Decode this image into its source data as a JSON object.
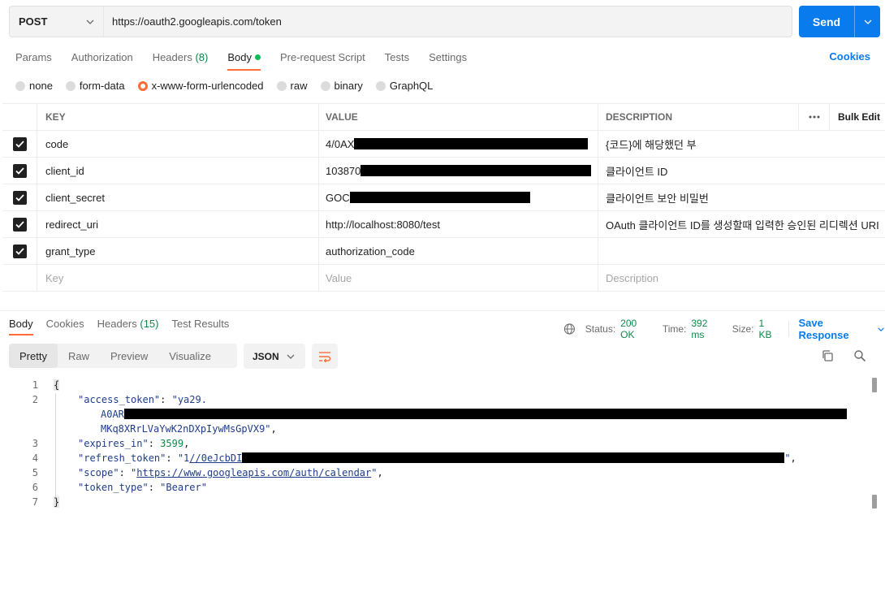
{
  "request": {
    "method": "POST",
    "url": "https://oauth2.googleapis.com/token",
    "send_label": "Send"
  },
  "tabs": {
    "params": "Params",
    "authorization": "Authorization",
    "headers": "Headers",
    "headers_count": "(8)",
    "body": "Body",
    "prerequest": "Pre-request Script",
    "tests": "Tests",
    "settings": "Settings",
    "cookies": "Cookies"
  },
  "body_types": {
    "none": "none",
    "form_data": "form-data",
    "urlencoded": "x-www-form-urlencoded",
    "raw": "raw",
    "binary": "binary",
    "graphql": "GraphQL"
  },
  "table": {
    "headers": {
      "key": "KEY",
      "value": "VALUE",
      "description": "DESCRIPTION",
      "bulk_edit": "Bulk Edit"
    },
    "rows": [
      {
        "key": "code",
        "value": "4/0AX",
        "description": "{코드}에 해당했던 부"
      },
      {
        "key": "client_id",
        "value": "103870",
        "description": "클라이언트 ID"
      },
      {
        "key": "client_secret",
        "value": "GOC",
        "description": "클라이언트 보안 비밀번"
      },
      {
        "key": "redirect_uri",
        "value": "http://localhost:8080/test",
        "description": "OAuth 클라이언트 ID를 생성할때 입력한 승인된 리디렉션 URI"
      },
      {
        "key": "grant_type",
        "value": "authorization_code",
        "description": ""
      }
    ],
    "placeholders": {
      "key": "Key",
      "value": "Value",
      "description": "Description"
    }
  },
  "response": {
    "tabs": {
      "body": "Body",
      "cookies": "Cookies",
      "headers": "Headers",
      "headers_count": "(15)",
      "test_results": "Test Results"
    },
    "status_label": "Status:",
    "status_value": "200 OK",
    "time_label": "Time:",
    "time_value": "392 ms",
    "size_label": "Size:",
    "size_value": "1 KB",
    "save_label": "Save Response",
    "views": {
      "pretty": "Pretty",
      "raw": "Raw",
      "preview": "Preview",
      "visualize": "Visualize"
    },
    "format": "JSON",
    "code": {
      "line_numbers": [
        "1",
        "2",
        "3",
        "4",
        "5",
        "6",
        "7"
      ],
      "open_brace": "{",
      "close_brace": "}",
      "access_token_key": "\"access_token\"",
      "access_token_start": "\"ya29.",
      "access_token_mid": "A0AR",
      "access_token_end": "MKq8XRrLVaYwK2nDXpIywMsGpVX9\"",
      "expires_in_key": "\"expires_in\"",
      "expires_in_value": "3599",
      "refresh_token_key": "\"refresh_token\"",
      "refresh_token_prefix": "\"1",
      "refresh_token_link": "//0eJcbDI",
      "refresh_token_suffix": "\"",
      "scope_key": "\"scope\"",
      "scope_value": "https://www.googleapis.com/auth/calendar",
      "token_type_key": "\"token_type\"",
      "token_type_value": "\"Bearer\""
    }
  },
  "colors": {
    "accent": "#ff6c37",
    "primary": "#097bed",
    "success": "#0d8a4a"
  },
  "icons": [
    "chevron-down-icon",
    "check-icon",
    "more-horizontal-icon",
    "globe-icon",
    "wrap-lines-icon",
    "copy-icon",
    "search-icon"
  ]
}
